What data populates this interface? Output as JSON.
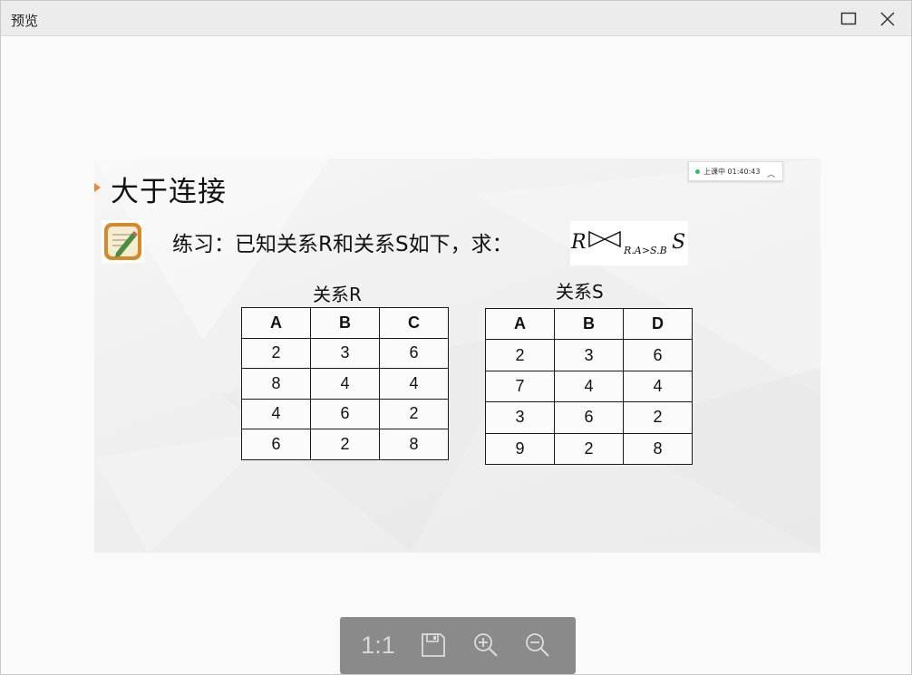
{
  "window": {
    "title": "预览",
    "controls": {
      "maximize_icon": "maximize-icon",
      "close_icon": "close-icon"
    }
  },
  "slide": {
    "title": "大于连接",
    "exercise": "练习：已知关系R和关系S如下，求：",
    "formula": {
      "left": "R",
      "operator": "⋈",
      "subscript": "R.A>S.B",
      "right": "S"
    },
    "status": {
      "text": "上课中 01:40:43",
      "color": "#2ebd6e"
    },
    "table_r": {
      "caption": "关系R",
      "headers": [
        "A",
        "B",
        "C"
      ],
      "rows": [
        [
          "2",
          "3",
          "6"
        ],
        [
          "8",
          "4",
          "4"
        ],
        [
          "4",
          "6",
          "2"
        ],
        [
          "6",
          "2",
          "8"
        ]
      ]
    },
    "table_s": {
      "caption": "关系S",
      "headers": [
        "A",
        "B",
        "D"
      ],
      "rows": [
        [
          "2",
          "3",
          "6"
        ],
        [
          "7",
          "4",
          "4"
        ],
        [
          "3",
          "6",
          "2"
        ],
        [
          "9",
          "2",
          "8"
        ]
      ]
    }
  },
  "toolbar": {
    "ratio_label": "1:1",
    "icons": [
      "save-icon",
      "zoom-in-icon",
      "zoom-out-icon"
    ]
  },
  "colors": {
    "bullet": "#e8883a",
    "toolbar_bg": "#8a8a8a"
  }
}
